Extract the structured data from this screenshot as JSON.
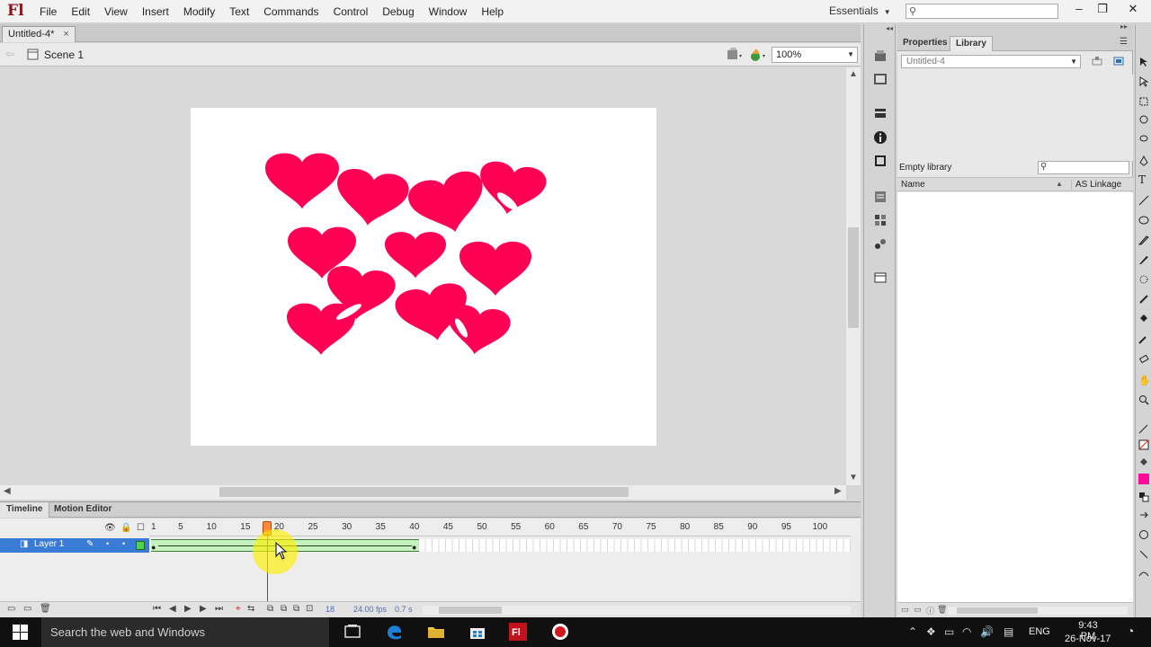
{
  "app": {
    "logo": "Fl"
  },
  "menu": [
    "File",
    "Edit",
    "View",
    "Insert",
    "Modify",
    "Text",
    "Commands",
    "Control",
    "Debug",
    "Window",
    "Help"
  ],
  "workspace": "Essentials",
  "document": {
    "tab_label": "Untitled-4*",
    "close_glyph": "×"
  },
  "editbar": {
    "scene_label": "Scene 1",
    "zoom_value": "100%"
  },
  "stage": {
    "background": "#ffffff",
    "heart_color": "#ff0055"
  },
  "timeline": {
    "tabs": [
      "Timeline",
      "Motion Editor"
    ],
    "layer_name": "Layer 1",
    "frame_ticks": [
      "1",
      "5",
      "10",
      "15",
      "20",
      "25",
      "30",
      "35",
      "40",
      "45",
      "50",
      "55",
      "60",
      "65",
      "70",
      "75",
      "80",
      "85",
      "90",
      "95",
      "100"
    ],
    "current_frame": "18",
    "fps": "24.00 fps",
    "elapsed": "0.7 s",
    "tween_span_frames": [
      1,
      40
    ],
    "playhead_frame": 18
  },
  "panel": {
    "tabs": [
      "Properties",
      "Library"
    ],
    "active_tab": "Library",
    "doc_selector": "Untitled-4",
    "empty_label": "Empty library",
    "columns": {
      "name": "Name",
      "linkage": "AS Linkage"
    }
  },
  "taskbar": {
    "search_placeholder": "Search the web and Windows",
    "language": "ENG",
    "time": "9:43 PM",
    "date": "26-Nov-17"
  }
}
